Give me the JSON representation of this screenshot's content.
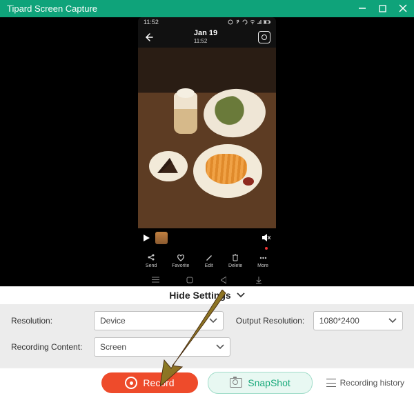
{
  "titlebar": {
    "title": "Tipard Screen Capture"
  },
  "phone": {
    "status_time": "11:52",
    "date": "Jan 19",
    "date_time": "11:52",
    "actions": [
      {
        "icon": "share-icon",
        "label": "Send"
      },
      {
        "icon": "heart-icon",
        "label": "Favorite"
      },
      {
        "icon": "pencil-icon",
        "label": "Edit"
      },
      {
        "icon": "trash-icon",
        "label": "Delete"
      },
      {
        "icon": "dots-icon",
        "label": "More"
      }
    ]
  },
  "hide_settings_label": "Hide Settings",
  "settings": {
    "resolution_label": "Resolution:",
    "resolution_value": "Device",
    "output_resolution_label": "Output Resolution:",
    "output_resolution_value": "1080*2400",
    "recording_content_label": "Recording Content:",
    "recording_content_value": "Screen"
  },
  "buttons": {
    "record": "Record",
    "snapshot": "SnapShot",
    "history": "Recording history"
  }
}
